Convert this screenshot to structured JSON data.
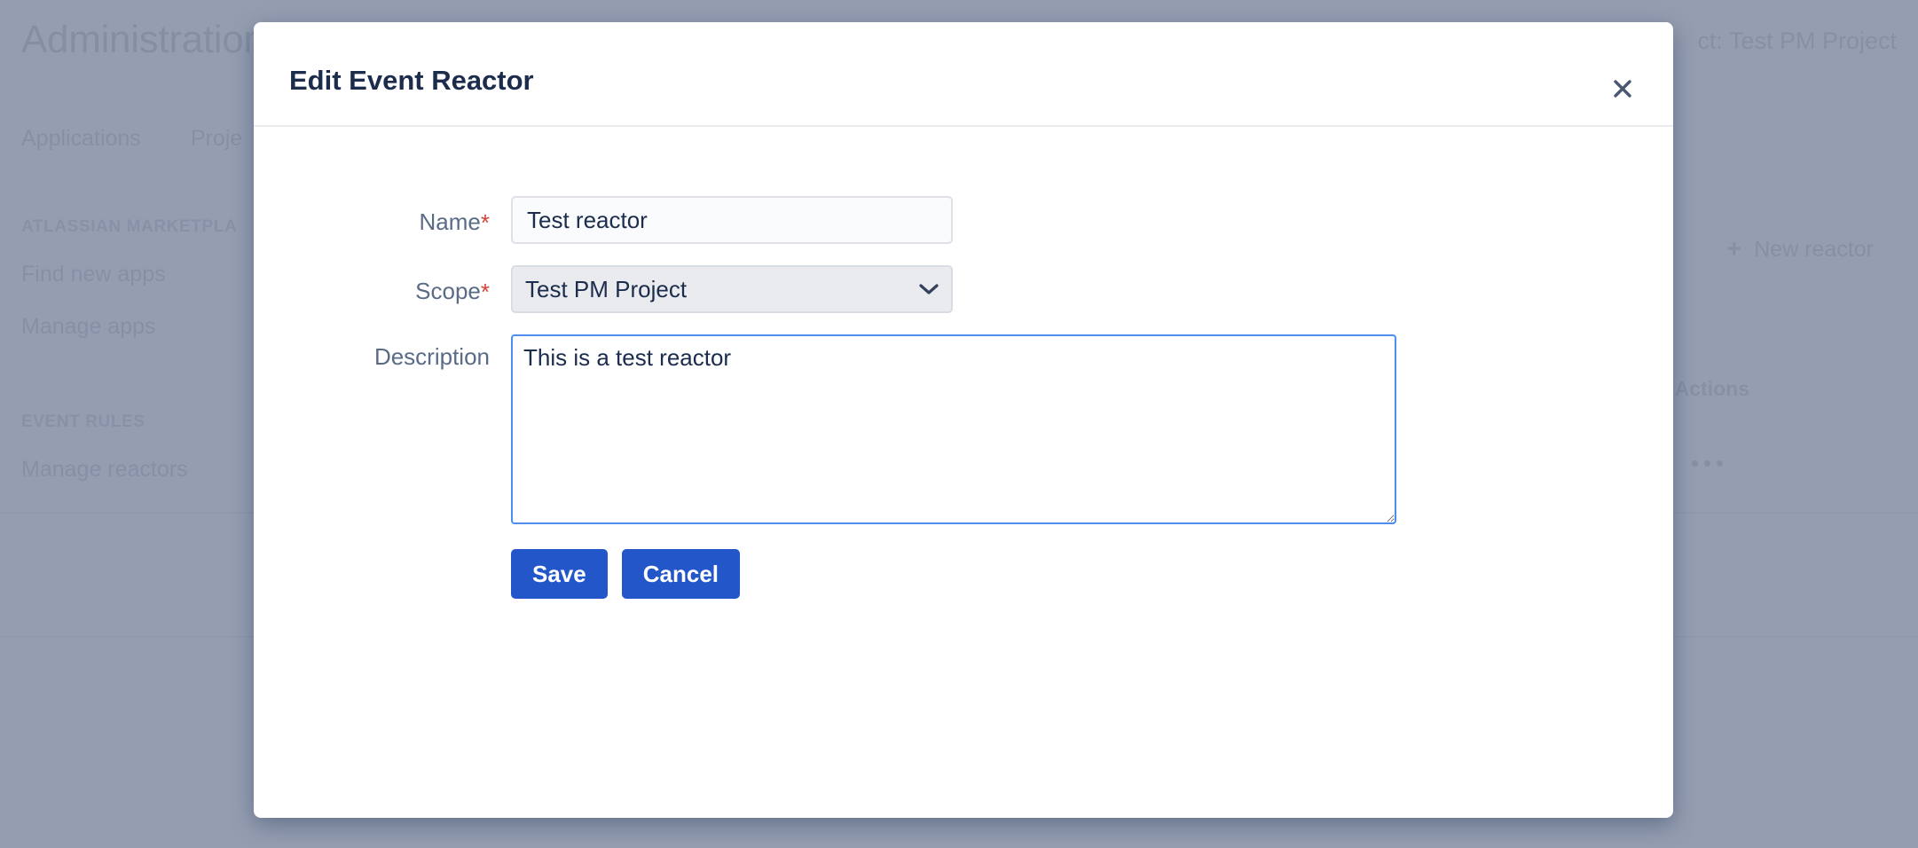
{
  "background": {
    "title": "Administration",
    "breadcrumb": "ct: Test PM Project",
    "tabs": [
      {
        "label": "Applications"
      },
      {
        "label": "Proje"
      }
    ],
    "sidebar": {
      "sections": [
        {
          "label": "ATLASSIAN MARKETPLA",
          "items": [
            {
              "label": "Find new apps"
            },
            {
              "label": "Manage apps"
            }
          ]
        },
        {
          "label": "EVENT RULES",
          "items": [
            {
              "label": "Manage reactors"
            }
          ]
        }
      ]
    },
    "new_reactor_button": {
      "icon": "plus-icon",
      "label": "New reactor"
    },
    "table": {
      "columns": [
        {
          "label": "Actions"
        }
      ],
      "row_action_icon": "ellipsis-icon"
    }
  },
  "modal": {
    "title": "Edit Event Reactor",
    "close_icon": "close-icon",
    "fields": {
      "name": {
        "label": "Name",
        "required_marker": "*",
        "value": "Test reactor",
        "placeholder": ""
      },
      "scope": {
        "label": "Scope",
        "required_marker": "*",
        "value": "Test PM Project",
        "options": [
          "Test PM Project"
        ],
        "chevron_icon": "chevron-down-icon"
      },
      "description": {
        "label": "Description",
        "value": "This is a test reactor",
        "placeholder": ""
      }
    },
    "buttons": {
      "save": "Save",
      "cancel": "Cancel"
    }
  },
  "colors": {
    "primary_blue": "#2357c9",
    "focus_blue": "#4c8ef0",
    "required_red": "#d04437",
    "text_dark": "#1c2c4d",
    "label_gray": "#5a6b86",
    "overlay": "#8d97ab"
  }
}
